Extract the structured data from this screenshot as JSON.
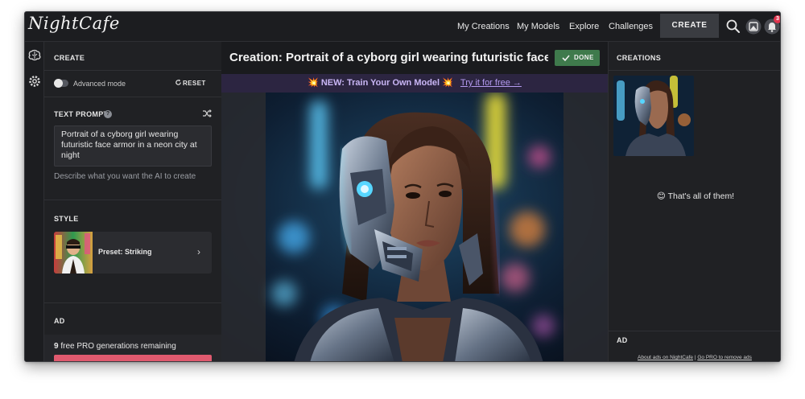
{
  "app": {
    "logo": "NightCafe"
  },
  "nav": {
    "items": [
      "My Creations",
      "My Models",
      "Explore",
      "Challenges"
    ],
    "create_label": "CREATE",
    "notification_count": "3"
  },
  "left_panel": {
    "header": "CREATE",
    "advanced_mode_label": "Advanced mode",
    "reset_label": "RESET",
    "text_prompt_label": "TEXT PROMPT",
    "help_glyph": "?",
    "prompt_value": "Portrait of a cyborg girl wearing futuristic face armor in a neon city at night",
    "prompt_hint": "Describe what you want the AI to create",
    "style_label": "STYLE",
    "preset_label": "Preset: Striking",
    "ad_label": "AD",
    "free_generations": "9 free PRO generations remaining"
  },
  "center": {
    "title": "Creation: Portrait of a cyborg girl wearing futuristic face armor in a neon city at night",
    "done_label": "DONE",
    "promo_text": "💥 NEW: Train Your Own Model 💥",
    "promo_link": "Try it for free →"
  },
  "right_panel": {
    "header": "CREATIONS",
    "end_message": "😊 That's all of them!",
    "ad_label": "AD",
    "ad_link_1": "About ads on NightCafe",
    "ad_separator": " | ",
    "ad_link_2": "Go PRO to remove ads"
  },
  "colors": {
    "background": "#1f2023",
    "done_green": "#3f7a4c",
    "promo_purple": "#2c2541",
    "pro_button": "#e05a6f",
    "badge_red": "#e0344d"
  },
  "icons": [
    "search-icon",
    "image-icon",
    "bell-icon",
    "brain-icon",
    "gear-icon",
    "shuffle-icon",
    "check-icon",
    "chevron-right-icon",
    "refresh-icon"
  ]
}
